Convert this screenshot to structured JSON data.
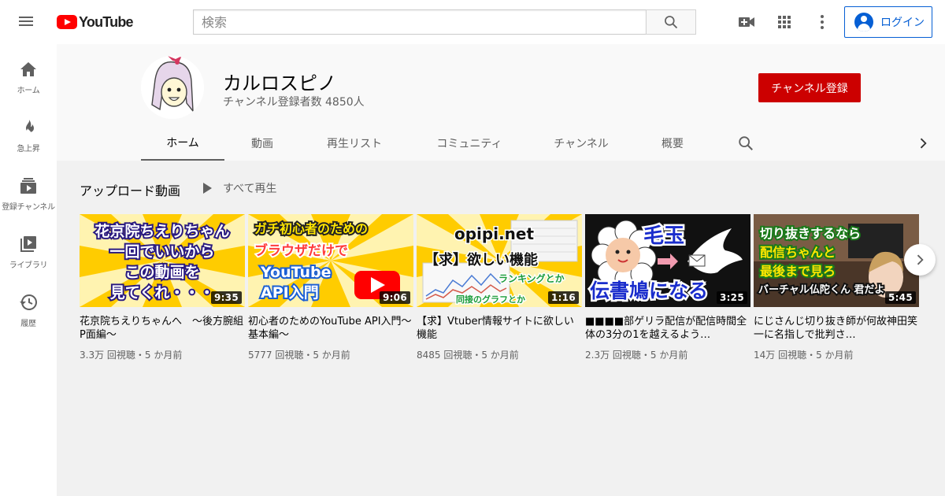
{
  "header": {
    "logo_text": "YouTube",
    "search_placeholder": "検索",
    "login_label": "ログイン",
    "icons": [
      "menu-icon",
      "search-icon",
      "video-camera-icon",
      "apps-grid-icon",
      "more-vert-icon",
      "account-icon"
    ]
  },
  "sidebar": {
    "items": [
      {
        "label": "ホーム",
        "icon": "home-icon"
      },
      {
        "label": "急上昇",
        "icon": "flame-icon"
      },
      {
        "label": "登録チャンネル",
        "icon": "subscriptions-icon"
      },
      {
        "label": "ライブラリ",
        "icon": "library-icon"
      },
      {
        "label": "履歴",
        "icon": "history-icon"
      }
    ]
  },
  "channel": {
    "name": "カルロスピノ",
    "subscribers": "チャンネル登録者数 4850人",
    "subscribe_label": "チャンネル登録",
    "tabs": [
      "ホーム",
      "動画",
      "再生リスト",
      "コミュニティ",
      "チャンネル",
      "概要"
    ],
    "active_tab": "ホーム"
  },
  "shelf": {
    "title": "アップロード動画",
    "play_all": "すべて再生",
    "videos": [
      {
        "thumb_text": [
          "花京院ちえりちゃん",
          "一回でいいから",
          "この動画を",
          "見てくれ・・・"
        ],
        "duration": "9:35",
        "title": "花京院ちえりちゃんへ　～後方腕組P面編～",
        "meta": "3.3万 回視聴・5 か月前"
      },
      {
        "thumb_text": [
          "ガチ初心者のための",
          "ブラウザだけで",
          "YouTube",
          "API入門"
        ],
        "duration": "9:06",
        "title": "初心者のためのYouTube API入門～基本編～",
        "meta": "5777 回視聴・5 か月前"
      },
      {
        "thumb_text": [
          "opipi.net",
          "【求】欲しい機能",
          "ランキングとか",
          "同接のグラフとか"
        ],
        "duration": "1:16",
        "title": "【求】Vtuber情報サイトに欲しい機能",
        "meta": "8485 回視聴・5 か月前"
      },
      {
        "thumb_text": [
          "毛玉",
          "伝書鳩になる"
        ],
        "duration": "3:25",
        "title": "■■■■部ゲリラ配信が配信時間全体の3分の1を越えるよう…",
        "meta": "2.3万 回視聴・5 か月前"
      },
      {
        "thumb_text": [
          "切り抜きするなら",
          "配信ちゃんと",
          "最後まで見ろ",
          "バーチャル仏陀くん 君だよ"
        ],
        "duration": "5:45",
        "title": "にじさんじ切り抜き師が何故神田笑一に名指しで批判さ…",
        "meta": "14万 回視聴・5 か月前"
      }
    ]
  },
  "colors": {
    "brand_red": "#ff0000",
    "subscribe_red": "#cc0000",
    "link_blue": "#065fd4"
  }
}
